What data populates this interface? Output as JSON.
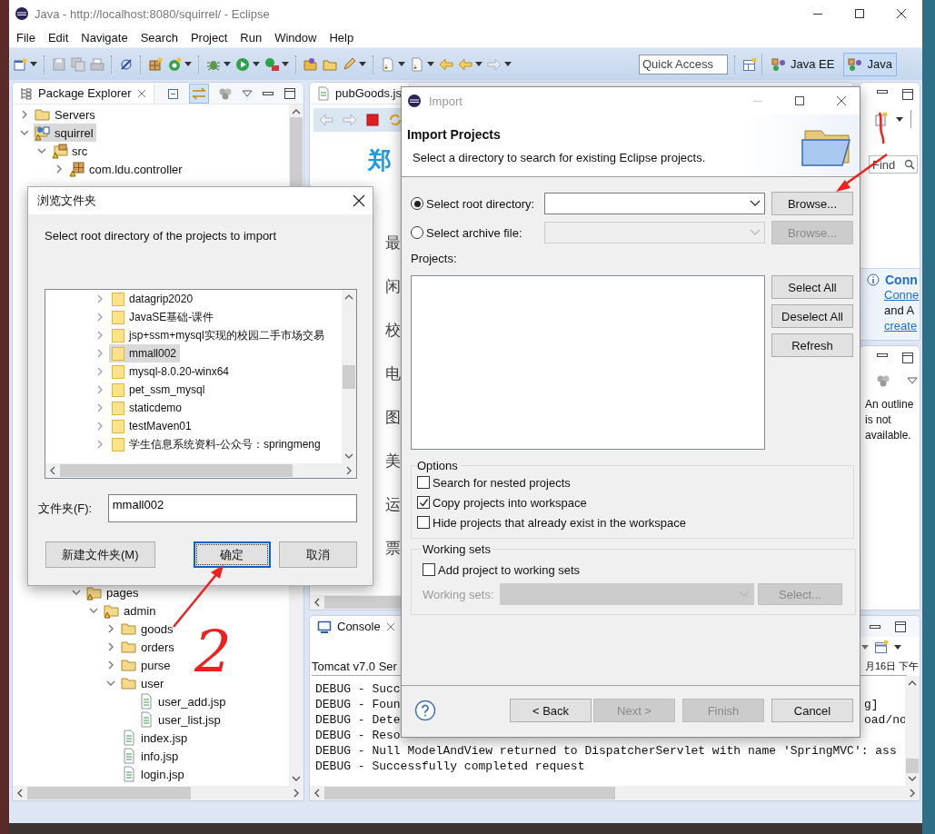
{
  "window": {
    "title": "Java - http://localhost:8080/squirrel/ - Eclipse"
  },
  "menu": [
    "File",
    "Edit",
    "Navigate",
    "Search",
    "Project",
    "Run",
    "Window",
    "Help"
  ],
  "quick_access": {
    "placeholder": "Quick Access"
  },
  "perspectives": [
    {
      "label": "Java EE",
      "selected": false
    },
    {
      "label": "Java",
      "selected": true
    }
  ],
  "package_explorer": {
    "title": "Package Explorer",
    "tree": [
      {
        "label": "Servers",
        "kind": "server-folder",
        "expanded": false,
        "selected": false
      },
      {
        "label": "squirrel",
        "kind": "project",
        "expanded": true,
        "selected": true,
        "children": [
          {
            "label": "src",
            "kind": "source",
            "expanded": true,
            "selected": false,
            "children": [
              {
                "label": "com.ldu.controller",
                "kind": "package",
                "expanded": false,
                "selected": false
              }
            ]
          }
        ]
      }
    ],
    "tree_continued": [
      {
        "label": "pages",
        "kind": "web-folder",
        "expanded": true,
        "selected": false,
        "children": [
          {
            "label": "admin",
            "kind": "web-folder",
            "expanded": true,
            "selected": false,
            "children": [
              {
                "label": "goods",
                "kind": "folder",
                "expanded": false,
                "selected": false
              },
              {
                "label": "orders",
                "kind": "folder",
                "expanded": false,
                "selected": false
              },
              {
                "label": "purse",
                "kind": "folder",
                "expanded": false,
                "selected": false
              },
              {
                "label": "user",
                "kind": "folder",
                "expanded": true,
                "selected": false,
                "children": [
                  {
                    "label": "user_add.jsp",
                    "kind": "file",
                    "selected": false
                  },
                  {
                    "label": "user_list.jsp",
                    "kind": "file",
                    "selected": false
                  }
                ]
              },
              {
                "label": "index.jsp",
                "kind": "file",
                "selected": false
              },
              {
                "label": "info.jsp",
                "kind": "file",
                "selected": false
              },
              {
                "label": "login.jsp",
                "kind": "file",
                "selected": false
              }
            ]
          }
        ]
      }
    ]
  },
  "editor": {
    "tab": "pubGoods.js",
    "heading": "郑",
    "column": [
      "最",
      "闲",
      "校",
      "电",
      "图",
      "美",
      "运",
      "票"
    ]
  },
  "right_panel": {
    "find": {
      "placeholder": "Find"
    },
    "connect": {
      "title": "Conn",
      "link": "Conne",
      "text": "and A",
      "link2": "create"
    },
    "outline_message": "An outline is not available."
  },
  "console": {
    "title": "Console",
    "server": "Tomcat v7.0 Ser",
    "server_tail": "月16日 下午",
    "lines": [
      {
        "text": "DEBUG - Succ"
      },
      {
        "text": "DEBUG - Foun",
        "tail": "g]"
      },
      {
        "text": "DEBUG - Dete",
        "tail": "oad/no"
      },
      {
        "text": "DEBUG - Reso"
      },
      {
        "text": "DEBUG - Null ModelAndView returned to DispatcherServlet with name 'SpringMVC': ass"
      },
      {
        "text": "DEBUG - Successfully completed request"
      }
    ]
  },
  "import_dialog": {
    "title": "Import",
    "heading": "Import Projects",
    "description": "Select a directory to search for existing Eclipse projects.",
    "sources": [
      {
        "label": "Select root directory:",
        "selected": true,
        "browse": "Browse..."
      },
      {
        "label": "Select archive file:",
        "selected": false,
        "browse": "Browse..."
      }
    ],
    "projects_label": "Projects:",
    "project_buttons": [
      "Select All",
      "Deselect All",
      "Refresh"
    ],
    "options": {
      "title": "Options",
      "items": [
        {
          "label": "Search for nested projects",
          "checked": false
        },
        {
          "label": "Copy projects into workspace",
          "checked": true
        },
        {
          "label": "Hide projects that already exist in the workspace",
          "checked": false
        }
      ]
    },
    "working_sets": {
      "title": "Working sets",
      "add": {
        "label": "Add project to working sets",
        "checked": false
      },
      "label": "Working sets:",
      "select": "Select..."
    },
    "buttons": [
      {
        "label": "< Back",
        "disabled": false
      },
      {
        "label": "Next >",
        "disabled": true
      },
      {
        "label": "Finish",
        "disabled": true
      },
      {
        "label": "Cancel",
        "disabled": false
      }
    ]
  },
  "browse_dialog": {
    "title": "浏览文件夹",
    "instruction": "Select root directory of the projects to import",
    "folders": [
      {
        "label": "datagrip2020",
        "selected": false
      },
      {
        "label": "JavaSE基础-课件",
        "selected": false
      },
      {
        "label": "jsp+ssm+mysql实现的校园二手市场交易",
        "selected": false
      },
      {
        "label": "mmall002",
        "selected": true
      },
      {
        "label": "mysql-8.0.20-winx64",
        "selected": false
      },
      {
        "label": "pet_ssm_mysql",
        "selected": false
      },
      {
        "label": "staticdemo",
        "selected": false
      },
      {
        "label": "testMaven01",
        "selected": false
      },
      {
        "label": "学生信息系统资料-公众号：springmeng",
        "selected": false
      }
    ],
    "folder_label": "文件夹(F):",
    "folder_value": "mmall002",
    "buttons": [
      {
        "label": "新建文件夹(M)",
        "default": false
      },
      {
        "label": "确定",
        "default": true
      },
      {
        "label": "取消",
        "default": false
      }
    ]
  },
  "annotation": {
    "text": "2"
  }
}
